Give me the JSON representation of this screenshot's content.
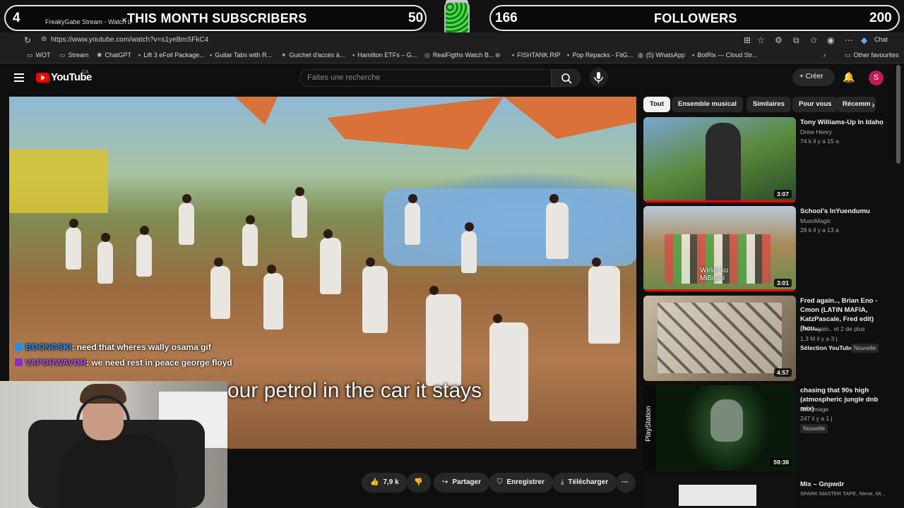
{
  "overlay": {
    "subscribers": {
      "current": "4",
      "label": "THIS MONTH SUBSCRIBERS",
      "goal": "50"
    },
    "followers": {
      "current": "166",
      "label": "FOLLOWERS",
      "goal": "200"
    }
  },
  "browser": {
    "tab_title": "FreakyGabe Stream - Watch L",
    "url": "https://www.youtube.com/watch?v=s1yeBmSFkC4",
    "chat_label": "Chat",
    "bookmarks": [
      "WOT",
      "Stream",
      "ChatGPT",
      "Lift 3 eFoil Package...",
      "Guitar Tabs with R...",
      "Guichet d'accès à...",
      "Hamilton ETFs – G...",
      "RealFigths Watch B...",
      "FISHTANK.RIP",
      "Pop Repacks - FitG...",
      "(5) WhatsApp",
      "BotRix — Cloud Str...",
      "Other favourites"
    ]
  },
  "youtube": {
    "logo": "YouTube",
    "country": "CA",
    "search_placeholder": "Faites une recherche",
    "create_label": "Créer",
    "avatar_letter": "S"
  },
  "video": {
    "subtitle": "our petrol in the car it stays",
    "chat": [
      {
        "user": "BOONGSKI",
        "user_color": "#1e90ff",
        "message": ": need that wheres wally osama gif"
      },
      {
        "user": "VAPORWAVOR",
        "user_color": "#8a2be2",
        "message": ": we need rest in peace george floyd"
      }
    ]
  },
  "actions": {
    "likes": "7,9 k",
    "share": "Partager",
    "save": "Enregistrer",
    "download": "Télécharger"
  },
  "chips": [
    "Tout",
    "Ensemble musical",
    "Similaires",
    "Pour vous",
    "Récemm"
  ],
  "recommendations": [
    {
      "title": "Tony Williams-Up In Idaho",
      "channel": "Drew Henry",
      "meta": "74 k  il y a 15 a",
      "duration": "3:07",
      "progress": 1.0,
      "thumb_colors": [
        "#5a8a3a",
        "#2a4a2a"
      ],
      "badge": ""
    },
    {
      "title": "School's InYuendumu",
      "channel": "MusoMagic",
      "meta": "28 k  il y a 13 a",
      "duration": "3:01",
      "progress": 1.0,
      "thumb_colors": [
        "#a88a5a",
        "#6a8a4a"
      ],
      "badge": ""
    },
    {
      "title": "Fred again.., Brian Eno - Cmon (LATIN MAFIA, KatzPascale, Fred edit) (hou...",
      "channel": "Fred again.. et 2 de plus",
      "meta": "1,3 M  il y a 3 j",
      "extra": "Sélection YouTube",
      "duration": "4:57",
      "progress": 0,
      "thumb_colors": [
        "#c8bca4",
        "#6a5a48"
      ],
      "badge": "Nouvelle"
    },
    {
      "title": "chasing that 90s high (atmospheric jungle dnb mix)",
      "channel": "afterimage",
      "meta": "247  il y a 1 j",
      "duration": "59:38",
      "progress": 0,
      "thumb_colors": [
        "#1a3a1a",
        "#0a1a0a"
      ],
      "badge": "Nouvelle"
    },
    {
      "title": "Mix – Gnpwdr",
      "channel": "SPARK MASTER TAPE, Nieve, Mi...",
      "meta": "",
      "duration": "",
      "progress": 0,
      "thumb_colors": [
        "#111",
        "#222"
      ],
      "badge": ""
    }
  ]
}
